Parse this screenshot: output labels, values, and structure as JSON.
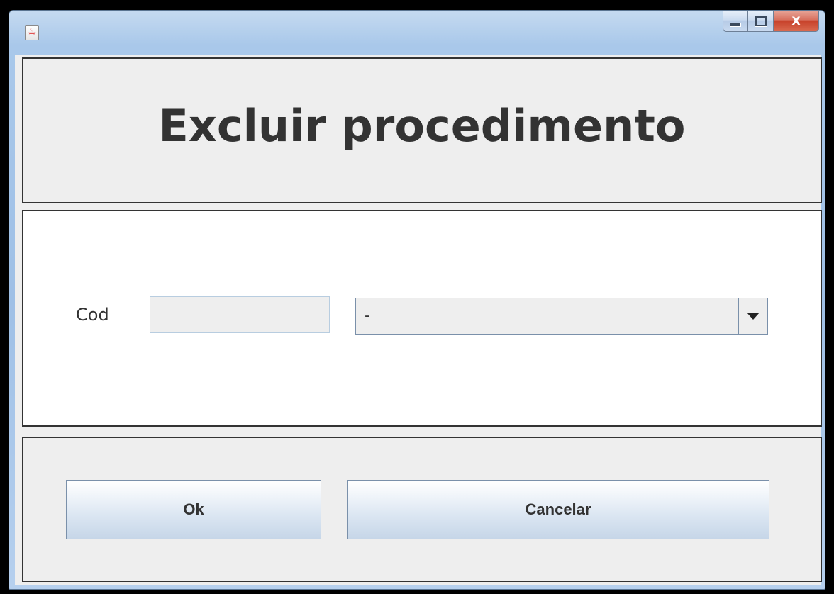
{
  "window": {
    "app_icon": "java-icon",
    "buttons": {
      "close_glyph": "X"
    }
  },
  "header": {
    "title": "Excluir procedimento"
  },
  "form": {
    "cod_label": "Cod",
    "cod_value": "",
    "combo_value": "-"
  },
  "actions": {
    "ok_label": "Ok",
    "cancel_label": "Cancelar"
  },
  "colors": {
    "client_bg": "#eeeeee",
    "form_bg": "#ffffff",
    "text": "#333333",
    "close_button": "#c7412a"
  }
}
